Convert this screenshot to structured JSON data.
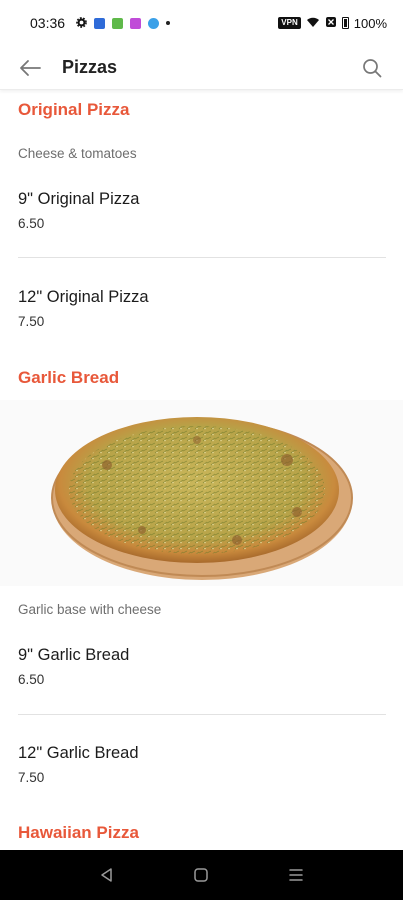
{
  "status_bar": {
    "time": "03:36",
    "battery": "100%",
    "vpn": "VPN"
  },
  "header": {
    "title": "Pizzas"
  },
  "sections": [
    {
      "title": "Original Pizza",
      "description": "Cheese & tomatoes",
      "items": [
        {
          "name": "9\" Original Pizza",
          "price": "6.50"
        },
        {
          "name": "12\" Original Pizza",
          "price": "7.50"
        }
      ]
    },
    {
      "title": "Garlic Bread",
      "description": "Garlic base with cheese",
      "items": [
        {
          "name": "9\" Garlic Bread",
          "price": "6.50"
        },
        {
          "name": "12\" Garlic Bread",
          "price": "7.50"
        }
      ]
    },
    {
      "title": "Hawaiian Pizza"
    }
  ],
  "colors": {
    "accent": "#e8583a",
    "divider": "#e2e2e2"
  },
  "icons": {
    "back": "arrow-left-icon",
    "search": "search-icon",
    "nav_back": "triangle-back-icon",
    "nav_home": "square-home-icon",
    "nav_recents": "menu-lines-icon"
  }
}
